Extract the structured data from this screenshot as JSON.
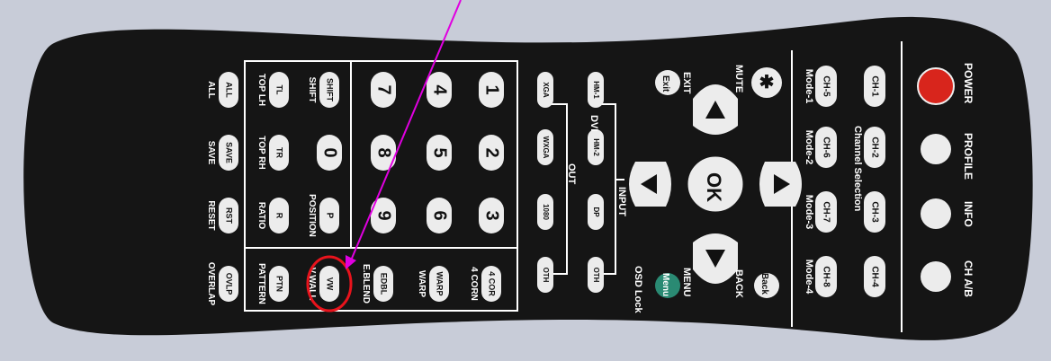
{
  "remote": {
    "power_label": "POWER",
    "profile_label": "PROFILE",
    "info_label": "INFO",
    "chab_label": "CH A/B",
    "channel_selection_label": "Channel Selection",
    "channel_buttons": [
      "CH-1",
      "CH-2",
      "CH-3",
      "CH-4",
      "CH-5",
      "CH-6",
      "CH-7",
      "CH-8"
    ],
    "mode_labels": [
      "Mode-1",
      "Mode-2",
      "Mode-3",
      "Mode-4"
    ],
    "mute_label": "MUTE",
    "exit_label": "EXIT",
    "exit_button": "Exit",
    "back_label": "BACK",
    "back_button": "Back",
    "menu_label": "MENU",
    "menu_button": "Menu",
    "osd_lock_label": "OSD Lock",
    "ok_label": "OK",
    "input_label": "INPUT",
    "input_buttons": [
      "HM-1",
      "HM-2",
      "DP",
      "OTH"
    ],
    "dvi_label": "DVI",
    "out_label": "OUT",
    "out_buttons": [
      "XGA",
      "WXGA",
      "1080",
      "OTH"
    ],
    "number_buttons": [
      "1",
      "2",
      "3",
      "4",
      "5",
      "6",
      "7",
      "8",
      "9",
      "0"
    ],
    "func_col1": [
      "4 COR",
      "WARP",
      "EDBL",
      "VW"
    ],
    "func_col1_labels": [
      "4 CORN",
      "WARP",
      "E.BLEND",
      "V.WALL"
    ],
    "position_button": "P",
    "position_label": "POSITION",
    "shift_button": "SHIFT",
    "shift_label": "SHIFT",
    "top_buttons": [
      "TL",
      "TR",
      "R",
      "PTN"
    ],
    "top_labels": [
      "TOP LH",
      "TOP RH",
      "RATIO",
      "PATTERN"
    ],
    "bottom_buttons": [
      "ALL",
      "SAVE",
      "RST",
      "OVLP"
    ],
    "bottom_labels": [
      "ALL",
      "SAVE",
      "RESET",
      "OVERLAP"
    ]
  },
  "colors": {
    "body": "#151515",
    "button": "#ececec",
    "power": "#d8251c",
    "menu": "#2a8a73",
    "highlight": "#e8131c",
    "arrow": "#e000e0"
  }
}
